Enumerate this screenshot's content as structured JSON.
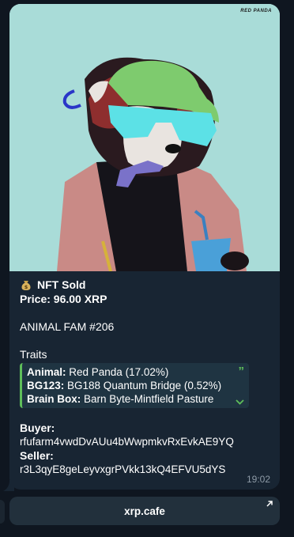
{
  "watermark": "RED PANDA",
  "message": {
    "title": "NFT Sold",
    "price": "Price: 96.00 XRP",
    "nft_name": "ANIMAL FAM #206",
    "traits_heading": "Traits",
    "traits": [
      {
        "key": "Animal:",
        "value": " Red Panda (17.02%)"
      },
      {
        "key": "BG123:",
        "value": " BG188 Quantum Bridge (0.52%)"
      },
      {
        "key": "Brain Box:",
        "value": " Barn Byte-Mintfield Pasture"
      }
    ],
    "buyer_label": "Buyer:",
    "buyer_address": "rfufarm4vwdDvAUu4bWwpmkvRxEvkAE9YQ",
    "seller_label": "Seller:",
    "seller_address": "r3L3qyE8geLeyvxgrPVkk13kQ4EFVU5dYS",
    "time": "19:02"
  },
  "button": {
    "label": "xrp.cafe"
  },
  "colors": {
    "bubble": "#182533",
    "background": "#0f1620",
    "art_bg": "#a9dcd8",
    "quote_accent": "#5fbf5a"
  }
}
